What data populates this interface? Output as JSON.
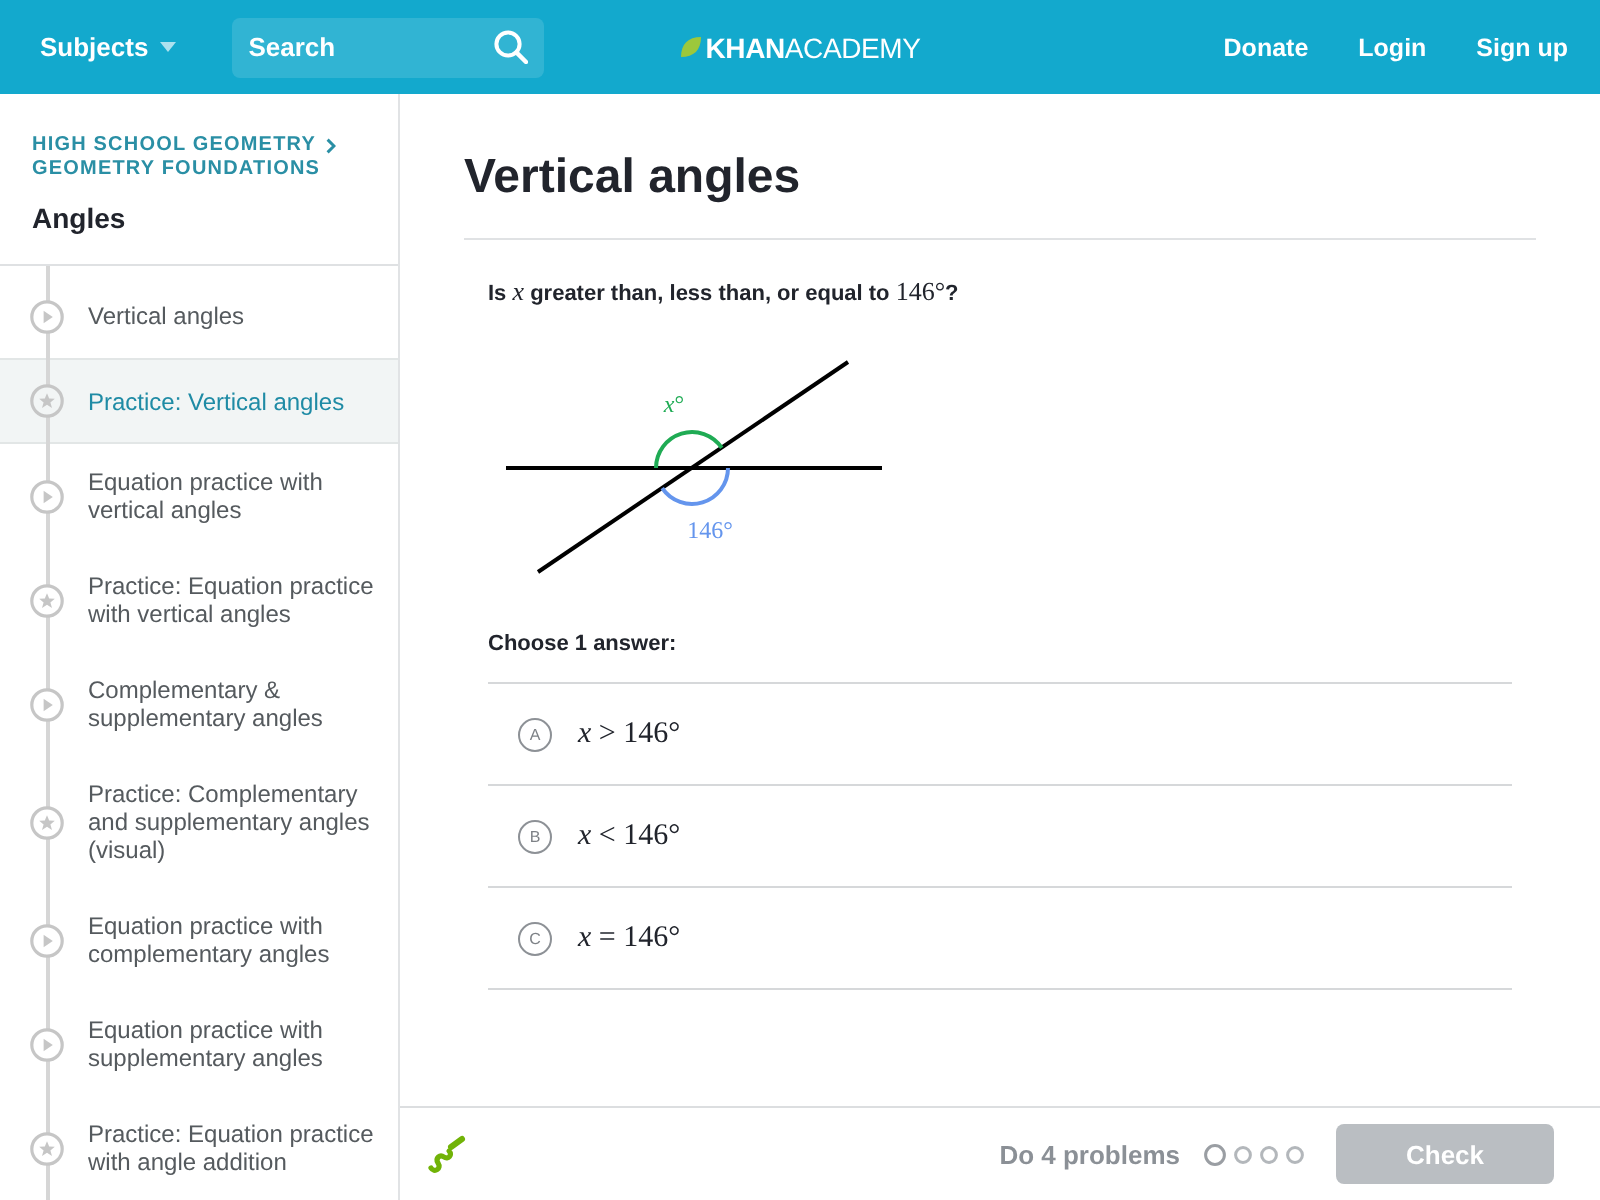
{
  "header": {
    "subjects": "Subjects",
    "search": {
      "placeholder": "Search"
    },
    "logo": "**KHAN**ACADEMY",
    "links": [
      "Donate",
      "Login",
      "Sign up"
    ]
  },
  "sidebar": {
    "breadcrumbs": [
      "HIGH SCHOOL GEOMETRY",
      "GEOMETRY FOUNDATIONS"
    ],
    "title": "Angles",
    "items": [
      {
        "kind": "video",
        "label": "Vertical angles",
        "selected": false
      },
      {
        "kind": "practice",
        "label": "Practice: Vertical angles",
        "selected": true
      },
      {
        "kind": "video",
        "label": "Equation practice with vertical angles",
        "selected": false
      },
      {
        "kind": "practice",
        "label": "Practice: Equation practice with vertical angles",
        "selected": false
      },
      {
        "kind": "video",
        "label": "Complementary & supplementary angles",
        "selected": false
      },
      {
        "kind": "practice",
        "label": "Practice: Complementary and supplementary angles (visual)",
        "selected": false
      },
      {
        "kind": "video",
        "label": "Equation practice with complementary angles",
        "selected": false
      },
      {
        "kind": "video",
        "label": "Equation practice with supplementary angles",
        "selected": false
      },
      {
        "kind": "practice",
        "label": "Practice: Equation practice with angle addition",
        "selected": false
      }
    ]
  },
  "exercise": {
    "title": "Vertical angles",
    "question": [
      {
        "kind": "text",
        "text": "Is "
      },
      {
        "kind": "math",
        "text": "x"
      },
      {
        "kind": "text",
        "text": " greater than, less than, or equal to "
      },
      {
        "kind": "math",
        "text": "146°"
      },
      {
        "kind": "text",
        "text": "?"
      }
    ],
    "diagram": {
      "angle_label": "x°",
      "given_label": "146°"
    },
    "prompt": "Choose 1 answer:",
    "choices": [
      {
        "letter": "A",
        "text": "x > 146°",
        "selected": false
      },
      {
        "letter": "B",
        "text": "x < 146°",
        "selected": false
      },
      {
        "letter": "C",
        "text": "x = 146°",
        "selected": false
      }
    ]
  },
  "footer": {
    "goal": "Do 4 problems",
    "dots": [
      {
        "current": true
      },
      {
        "current": false
      },
      {
        "current": false
      },
      {
        "current": false
      }
    ],
    "check": {
      "label": "Check",
      "disabled": true
    }
  }
}
